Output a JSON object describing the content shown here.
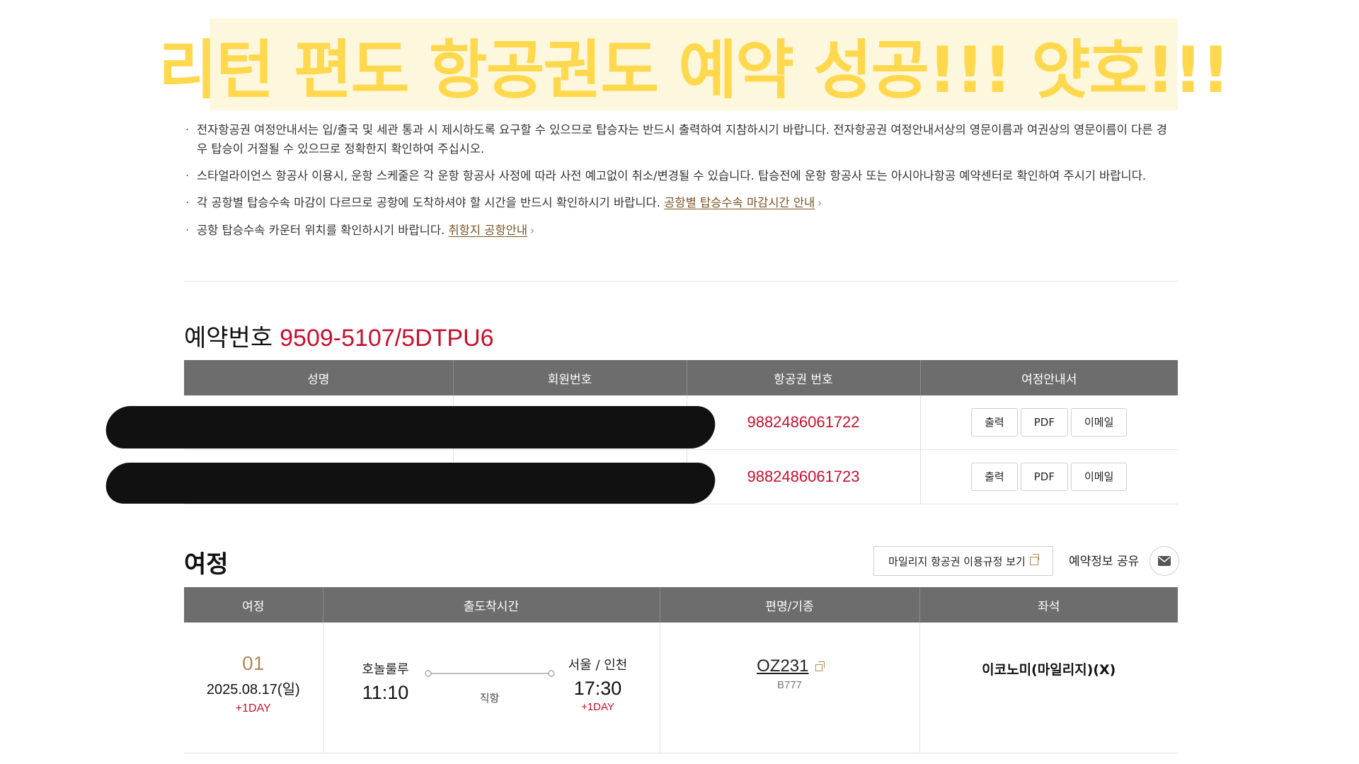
{
  "banner": {
    "text": "리턴 편도 항공권도 예약 성공!!! 얏호!!!"
  },
  "notices": [
    "전자항공권 여정안내서는 입/출국 및 세관 통과 시 제시하도록 요구할 수 있으므로 탑승자는 반드시 출력하여 지참하시기 바랍니다. 전자항공권 여정안내서상의 영문이름과 여권상의 영문이름이 다른 경우 탑승이 거절될 수 있으므로 정확한지 확인하여 주십시오.",
    "스타얼라이언스 항공사 이용시, 운항 스케줄은 각 운항 항공사 사정에 따라 사전 예고없이 취소/변경될 수 있습니다. 탑승전에 운항 항공사 또는 아시아나항공 예약센터로 확인하여 주시기 바랍니다.",
    "각 공항별 탑승수속 마감이 다르므로 공항에 도착하셔야 할 시간을 반드시 확인하시기 바랍니다.",
    "공항 탑승수속 카운터 위치를 확인하시기 바랍니다."
  ],
  "notice_links": {
    "checkin_deadline": "공항별 탑승수속 마감시간 안내",
    "airport_info": "취항지 공항안내"
  },
  "reservation": {
    "label": "예약번호",
    "number": "9509-5107/5DTPU6",
    "columns": [
      "성명",
      "회원번호",
      "항공권 번호",
      "여정안내서"
    ],
    "rows": [
      {
        "name": "",
        "member_no": "",
        "ticket_no": "9882486061722"
      },
      {
        "name": "",
        "member_no": "",
        "ticket_no": "9882486061723"
      }
    ],
    "buttons": {
      "print": "출력",
      "pdf": "PDF",
      "email": "이메일"
    }
  },
  "itinerary": {
    "title": "여정",
    "rule_button": "마일리지 항공권 이용규정 보기",
    "share_label": "예약정보 공유",
    "columns": [
      "여정",
      "출도착시간",
      "편명/기종",
      "좌석"
    ],
    "segment": {
      "no": "01",
      "date": "2025.08.17(일)",
      "date_plus": "+1DAY",
      "from_city": "호놀룰루",
      "dep_time": "11:10",
      "route_type": "직항",
      "to_city": "서울 / 인천",
      "arr_time": "17:30",
      "arr_plus": "+1DAY",
      "flight": "OZ231",
      "aircraft": "B777",
      "cabin": "이코노미(마일리지)(X)"
    }
  },
  "colors": {
    "accent_red": "#c8102e",
    "header_gray": "#6d6d6d",
    "link_brown": "#7a5223",
    "banner_yellow": "#ffd84d"
  }
}
